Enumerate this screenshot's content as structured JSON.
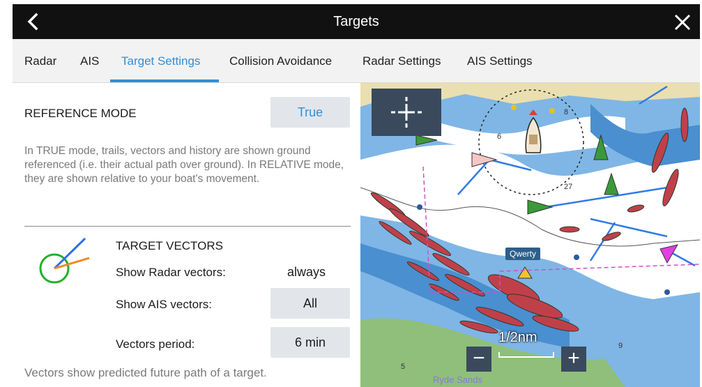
{
  "header": {
    "title": "Targets"
  },
  "tabs": [
    {
      "label": "Radar"
    },
    {
      "label": "AIS"
    },
    {
      "label": "Target Settings"
    },
    {
      "label": "Collision Avoidance"
    },
    {
      "label": "Radar Settings"
    },
    {
      "label": "AIS Settings"
    }
  ],
  "active_tab": "Target Settings",
  "reference_mode": {
    "label": "REFERENCE MODE",
    "value": "True",
    "description": "In TRUE mode, trails, vectors and history are shown ground referenced (i.e. their actual path over ground). In RELATIVE mode, they are shown relative to your boat's movement."
  },
  "target_vectors": {
    "heading": "TARGET VECTORS",
    "radar_label": "Show Radar vectors:",
    "radar_value": "always",
    "ais_label": "Show AIS vectors:",
    "ais_value": "All",
    "period_label": "Vectors period:",
    "period_value": "6 min",
    "footer": "Vectors show predicted future path of a target."
  },
  "chart": {
    "target_name": "Qwerty",
    "scale": "1/2nm",
    "zoom_out": "−",
    "zoom_in": "+",
    "place_name": "Ryde Sands",
    "depth_labels": [
      "8",
      "6",
      "5",
      "9",
      "27"
    ],
    "colors": {
      "deep_water": "#ffffff",
      "shallow_water": "#7fb6e6",
      "very_shallow": "#4a8fd0",
      "land": "#eadfb0",
      "green_land": "#8fbf7a",
      "radar_echo": "#c0404a",
      "vector_line": "#2f7ae8",
      "accent": "#2f8fd8"
    }
  },
  "icons": {
    "back": "chevron-left-icon",
    "close": "close-icon",
    "cursor": "crosshair-icon",
    "vectors": "target-vector-icon"
  }
}
